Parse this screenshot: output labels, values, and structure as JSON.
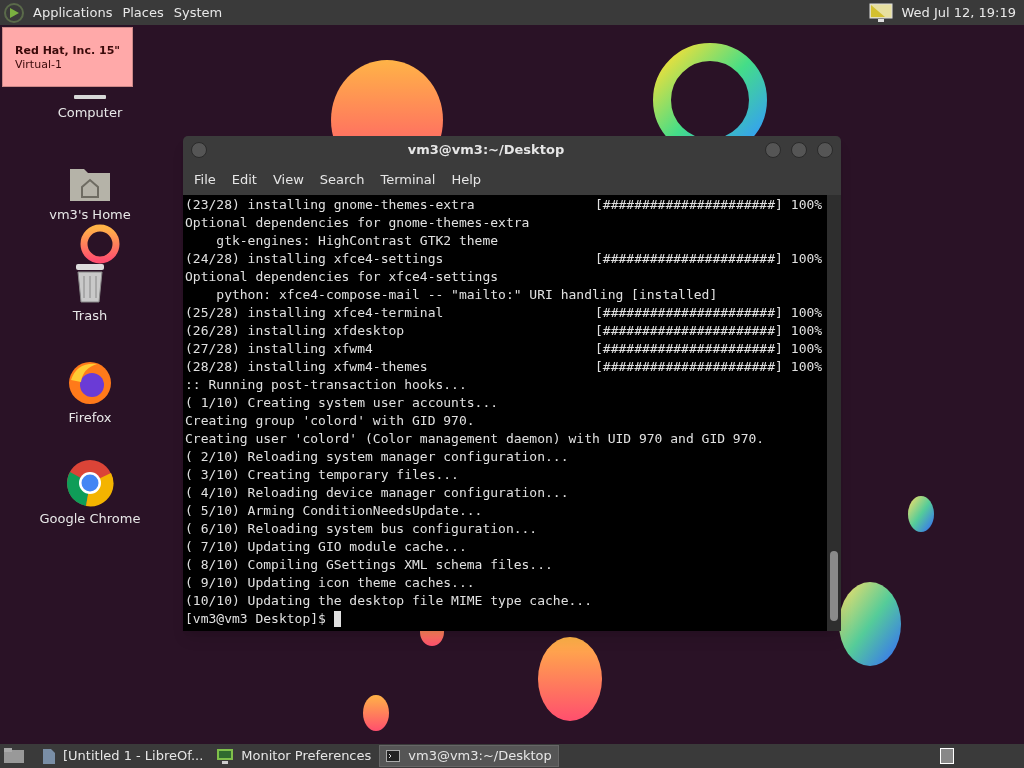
{
  "top_panel": {
    "menus": [
      "Applications",
      "Places",
      "System"
    ],
    "clock": "Wed Jul 12, 19:19"
  },
  "notification": {
    "title": "Red Hat, Inc. 15\"",
    "subtitle": "Virtual-1"
  },
  "desktop_icons": [
    {
      "kind": "computer",
      "label": "Computer"
    },
    {
      "kind": "home",
      "label": "vm3's Home"
    },
    {
      "kind": "trash",
      "label": "Trash"
    },
    {
      "kind": "firefox",
      "label": "Firefox"
    },
    {
      "kind": "chrome",
      "label": "Google Chrome"
    }
  ],
  "terminal": {
    "title": "vm3@vm3:~/Desktop",
    "menu": [
      "File",
      "Edit",
      "View",
      "Search",
      "Terminal",
      "Help"
    ],
    "lines": [
      {
        "text": "(23/28) installing gnome-themes-extra",
        "bar": "[######################]",
        "percent": "100%"
      },
      {
        "text": "Optional dependencies for gnome-themes-extra"
      },
      {
        "text": "    gtk-engines: HighContrast GTK2 theme"
      },
      {
        "text": "(24/28) installing xfce4-settings",
        "bar": "[######################]",
        "percent": "100%"
      },
      {
        "text": "Optional dependencies for xfce4-settings"
      },
      {
        "text": "    python: xfce4-compose-mail -- \"mailto:\" URI handling [installed]"
      },
      {
        "text": "(25/28) installing xfce4-terminal",
        "bar": "[######################]",
        "percent": "100%"
      },
      {
        "text": "(26/28) installing xfdesktop",
        "bar": "[######################]",
        "percent": "100%"
      },
      {
        "text": "(27/28) installing xfwm4",
        "bar": "[######################]",
        "percent": "100%"
      },
      {
        "text": "(28/28) installing xfwm4-themes",
        "bar": "[######################]",
        "percent": "100%"
      },
      {
        "text": ":: Running post-transaction hooks..."
      },
      {
        "text": "( 1/10) Creating system user accounts..."
      },
      {
        "text": "Creating group 'colord' with GID 970."
      },
      {
        "text": "Creating user 'colord' (Color management daemon) with UID 970 and GID 970."
      },
      {
        "text": "( 2/10) Reloading system manager configuration..."
      },
      {
        "text": "( 3/10) Creating temporary files..."
      },
      {
        "text": "( 4/10) Reloading device manager configuration..."
      },
      {
        "text": "( 5/10) Arming ConditionNeedsUpdate..."
      },
      {
        "text": "( 6/10) Reloading system bus configuration..."
      },
      {
        "text": "( 7/10) Updating GIO module cache..."
      },
      {
        "text": "( 8/10) Compiling GSettings XML schema files..."
      },
      {
        "text": "( 9/10) Updating icon theme caches..."
      },
      {
        "text": "(10/10) Updating the desktop file MIME type cache..."
      }
    ],
    "prompt": "[vm3@vm3 Desktop]$"
  },
  "taskbar": [
    {
      "kind": "document",
      "label": "[Untitled 1 - LibreOf...",
      "selected": false
    },
    {
      "kind": "monitor",
      "label": "Monitor Preferences",
      "selected": false
    },
    {
      "kind": "terminal",
      "label": "vm3@vm3:~/Desktop",
      "selected": true
    }
  ]
}
